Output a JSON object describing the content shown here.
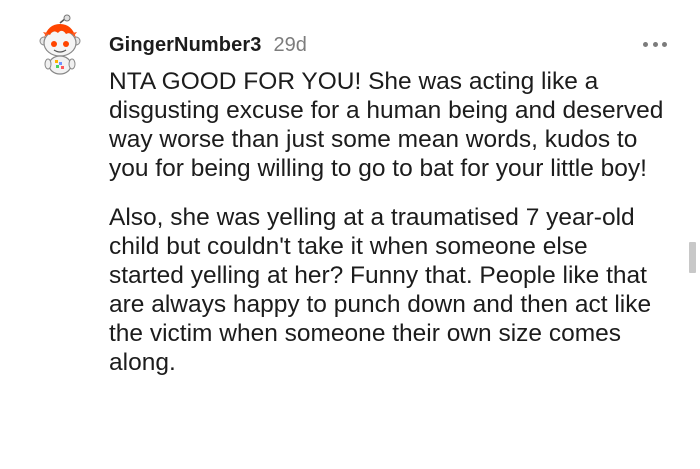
{
  "comment": {
    "author": "GingerNumber3",
    "age": "29d",
    "avatar_icon": "snoo-avatar-icon",
    "more_icon": "more-options-icon",
    "paragraphs": [
      "NTA GOOD FOR YOU! She was acting like a disgusting excuse for a human being and deserved way worse than just some mean words, kudos to you for being willing to go to bat for your little boy!",
      "Also, she was yelling at a traumatised 7 year-old child but couldn't take it when someone else started yelling at her? Funny that. People like that are always happy to punch down and then act like the victim when someone their own size comes along."
    ]
  },
  "colors": {
    "text": "#1c1c1c",
    "meta": "#7c7c7c",
    "avatar_hair": "#ff4500",
    "avatar_body": "#f2f2f2"
  }
}
